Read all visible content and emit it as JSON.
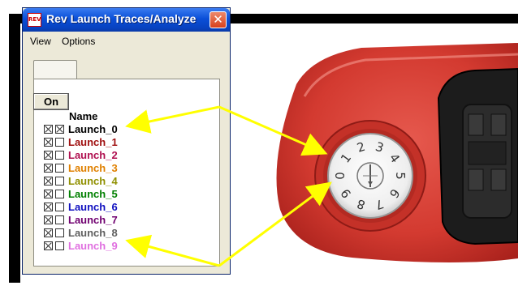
{
  "window": {
    "title": "Rev Launch Traces/Analyze",
    "close_glyph": "✕",
    "icon_text": "REV"
  },
  "menu": [
    {
      "label": "View"
    },
    {
      "label": "Options"
    }
  ],
  "panel": {
    "on_button": "On",
    "name_header": "Name",
    "items": [
      {
        "label": "Launch_0",
        "color": "#000000",
        "visible": true,
        "selected": true
      },
      {
        "label": "Launch_1",
        "color": "#a01010",
        "visible": true,
        "selected": false
      },
      {
        "label": "Launch_2",
        "color": "#b01050",
        "visible": true,
        "selected": false
      },
      {
        "label": "Launch_3",
        "color": "#e08000",
        "visible": true,
        "selected": false
      },
      {
        "label": "Launch_4",
        "color": "#909000",
        "visible": true,
        "selected": false
      },
      {
        "label": "Launch_5",
        "color": "#008000",
        "visible": true,
        "selected": false
      },
      {
        "label": "Launch_6",
        "color": "#1010c0",
        "visible": true,
        "selected": false
      },
      {
        "label": "Launch_7",
        "color": "#700070",
        "visible": true,
        "selected": false
      },
      {
        "label": "Launch_8",
        "color": "#606060",
        "visible": true,
        "selected": false
      },
      {
        "label": "Launch_9",
        "color": "#e070e0",
        "visible": true,
        "selected": false
      }
    ]
  },
  "dial": {
    "digits": [
      "0",
      "1",
      "2",
      "3",
      "4",
      "5",
      "6",
      "7",
      "8",
      "9"
    ]
  },
  "colors": {
    "arrow": "#ffff00",
    "device_red": "#d83a30",
    "titlebar": "#0a4fd8"
  }
}
